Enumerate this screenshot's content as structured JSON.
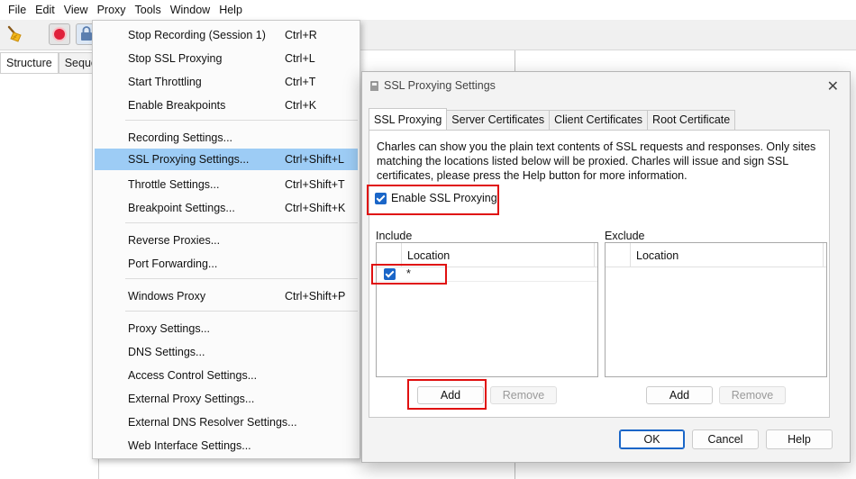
{
  "menubar": [
    "File",
    "Edit",
    "View",
    "Proxy",
    "Tools",
    "Window",
    "Help"
  ],
  "left_tabs": [
    "Structure",
    "Sequer"
  ],
  "proxy_menu": {
    "items": [
      {
        "label": "Stop Recording (Session 1)",
        "shortcut": "Ctrl+R"
      },
      {
        "label": "Stop SSL Proxying",
        "shortcut": "Ctrl+L"
      },
      {
        "label": "Start Throttling",
        "shortcut": "Ctrl+T"
      },
      {
        "label": "Enable Breakpoints",
        "shortcut": "Ctrl+K"
      },
      {
        "label": "Recording Settings...",
        "shortcut": ""
      },
      {
        "label": "SSL Proxying Settings...",
        "shortcut": "Ctrl+Shift+L",
        "highlighted": true
      },
      {
        "label": "Throttle Settings...",
        "shortcut": "Ctrl+Shift+T"
      },
      {
        "label": "Breakpoint Settings...",
        "shortcut": "Ctrl+Shift+K"
      },
      {
        "label": "Reverse Proxies...",
        "shortcut": ""
      },
      {
        "label": "Port Forwarding...",
        "shortcut": ""
      },
      {
        "label": "Windows Proxy",
        "shortcut": "Ctrl+Shift+P"
      },
      {
        "label": "Proxy Settings...",
        "shortcut": ""
      },
      {
        "label": "DNS Settings...",
        "shortcut": ""
      },
      {
        "label": "Access Control Settings...",
        "shortcut": ""
      },
      {
        "label": "External Proxy Settings...",
        "shortcut": ""
      },
      {
        "label": "External DNS Resolver Settings...",
        "shortcut": ""
      },
      {
        "label": "Web Interface Settings...",
        "shortcut": ""
      }
    ]
  },
  "dialog": {
    "title": "SSL Proxying Settings",
    "close": "✕",
    "tabs": [
      "SSL Proxying",
      "Server Certificates",
      "Client Certificates",
      "Root Certificate"
    ],
    "description": "Charles can show you the plain text contents of SSL requests and responses. Only sites matching the locations listed below will be proxied. Charles will issue and sign SSL certificates, please press the Help button for more information.",
    "enable_label": "Enable SSL Proxying",
    "enable_checked": true,
    "include": {
      "label": "Include",
      "column": "Location",
      "rows": [
        {
          "checked": true,
          "location": "*"
        }
      ],
      "add": "Add",
      "remove": "Remove"
    },
    "exclude": {
      "label": "Exclude",
      "column": "Location",
      "rows": [],
      "add": "Add",
      "remove": "Remove"
    },
    "ok": "OK",
    "cancel": "Cancel",
    "help": "Help"
  },
  "colors": {
    "menu_highlight": "#9dccf5",
    "annotation": "#e01010",
    "checkbox": "#1a66c8"
  }
}
